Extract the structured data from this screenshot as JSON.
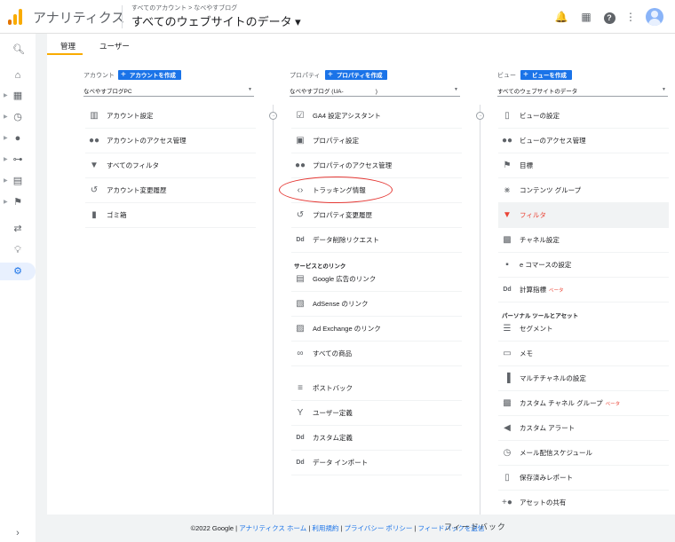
{
  "header": {
    "app_title": "アナリティクス",
    "breadcrumb": "すべてのアカウント > なべやすブログ",
    "property_title": "すべてのウェブサイトのデータ ▾",
    "icons": [
      "bell-icon",
      "apps-icon",
      "help-icon",
      "more-icon",
      "account-avatar"
    ]
  },
  "tabs": {
    "admin": "管理",
    "user": "ユーザー"
  },
  "account": {
    "label": "アカウント",
    "create": "アカウントを作成",
    "selected": "なべやすブログPC",
    "items": [
      {
        "label": "アカウント設定",
        "icon": "building-icon"
      },
      {
        "label": "アカウントのアクセス管理",
        "icon": "people-icon"
      },
      {
        "label": "すべてのフィルタ",
        "icon": "filter-icon"
      },
      {
        "label": "アカウント変更履歴",
        "icon": "history-icon"
      },
      {
        "label": "ゴミ箱",
        "icon": "trash-icon"
      }
    ]
  },
  "property": {
    "label": "プロパティ",
    "create": "プロパティを作成",
    "selected": "なべやすブログ (UA-                    )",
    "items": [
      {
        "label": "GA4 設定アシスタント",
        "icon": "checklist-icon"
      },
      {
        "label": "プロパティ設定",
        "icon": "window-icon"
      },
      {
        "label": "プロパティのアクセス管理",
        "icon": "people-icon"
      },
      {
        "label": "トラッキング情報",
        "icon": "code-icon"
      },
      {
        "label": "プロパティ変更履歴",
        "icon": "history-icon"
      },
      {
        "label": "データ削除リクエスト",
        "icon": "dd-icon"
      }
    ],
    "links_section": "サービスとのリンク",
    "links": [
      {
        "label": "Google 広告のリンク",
        "icon": "ads-icon"
      },
      {
        "label": "AdSense のリンク",
        "icon": "adsense-icon"
      },
      {
        "label": "Ad Exchange のリンク",
        "icon": "adexchange-icon"
      },
      {
        "label": "すべての商品",
        "icon": "link-icon"
      }
    ],
    "more": [
      {
        "label": "ポストバック",
        "icon": "postback-icon"
      },
      {
        "label": "ユーザー定義",
        "icon": "fork-icon"
      },
      {
        "label": "カスタム定義",
        "icon": "dd-icon"
      },
      {
        "label": "データ インポート",
        "icon": "dd-icon"
      }
    ]
  },
  "view": {
    "label": "ビュー",
    "create": "ビューを作成",
    "selected": "すべてのウェブサイトのデータ",
    "items": [
      {
        "label": "ビューの設定",
        "icon": "doc-icon"
      },
      {
        "label": "ビューのアクセス管理",
        "icon": "people-icon"
      },
      {
        "label": "目標",
        "icon": "flag-icon"
      },
      {
        "label": "コンテンツ グループ",
        "icon": "figure-icon"
      },
      {
        "label": "フィルタ",
        "icon": "filter-icon"
      },
      {
        "label": "チャネル設定",
        "icon": "channel-icon"
      },
      {
        "label": "e コマースの設定",
        "icon": "cart-icon"
      },
      {
        "label": "計算指標",
        "icon": "dd-icon",
        "badge": "ベータ"
      }
    ],
    "personal_section": "パーソナル ツールとアセット",
    "personal": [
      {
        "label": "セグメント",
        "icon": "segment-icon"
      },
      {
        "label": "メモ",
        "icon": "note-icon"
      },
      {
        "label": "マルチチャネルの設定",
        "icon": "bars-icon"
      },
      {
        "label": "カスタム チャネル グループ",
        "icon": "channel-icon",
        "badge": "ベータ"
      },
      {
        "label": "カスタム アラート",
        "icon": "megaphone-icon"
      },
      {
        "label": "メール配信スケジュール",
        "icon": "clock-icon"
      },
      {
        "label": "保存済みレポート",
        "icon": "doc-icon"
      },
      {
        "label": "アセットの共有",
        "icon": "person-add-icon"
      }
    ]
  },
  "footer": {
    "copyright": "©2022 Google",
    "links": [
      "アナリティクス ホーム",
      "利用規約",
      "プライバシー ポリシー"
    ],
    "feedback": "フィードバックを送信",
    "overlay": "フィードバック"
  }
}
